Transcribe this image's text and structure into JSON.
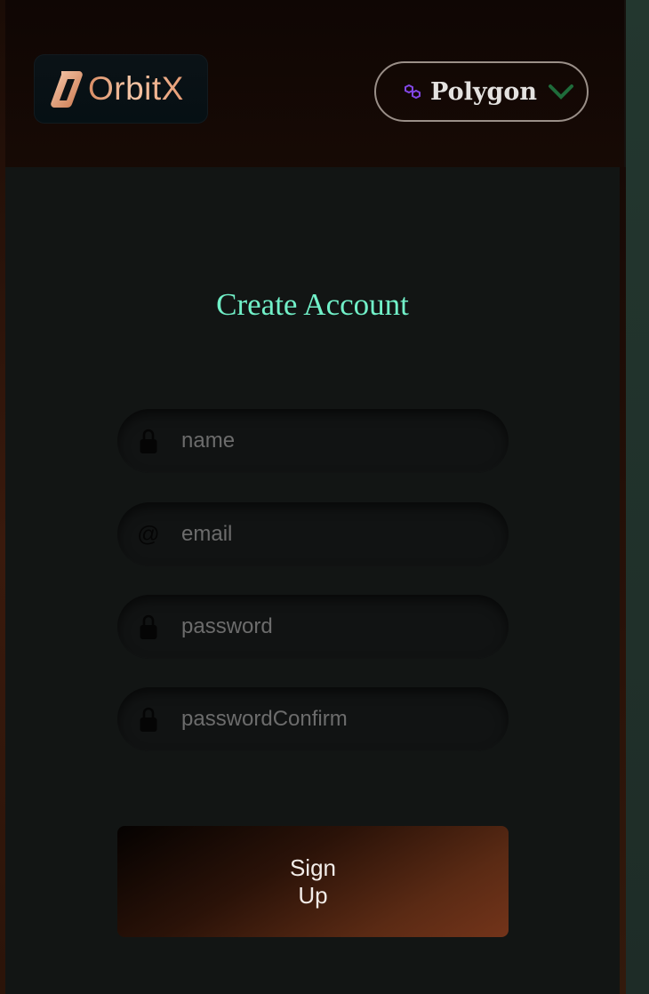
{
  "header": {
    "logo_text": "OrbitX",
    "network": {
      "label": "Polygon",
      "icon": "polygon-icon",
      "chevron_icon": "chevron-down-icon"
    }
  },
  "form": {
    "title": "Create Account",
    "fields": [
      {
        "placeholder": "name",
        "icon": "lock-icon"
      },
      {
        "placeholder": "email",
        "icon": "at-icon"
      },
      {
        "placeholder": "password",
        "icon": "lock-icon"
      },
      {
        "placeholder": "passwordConfirm",
        "icon": "lock-icon"
      }
    ],
    "submit_label": "Sign Up"
  },
  "colors": {
    "title": "#71f0c8",
    "logo_gradient_start": "#d98c63",
    "logo_gradient_end": "#f6c8a9",
    "polygon_purple": "#8247e5",
    "chevron_green": "#1f6b3a",
    "panel_background": "#121514",
    "signup_gradient_end": "#73341a"
  }
}
